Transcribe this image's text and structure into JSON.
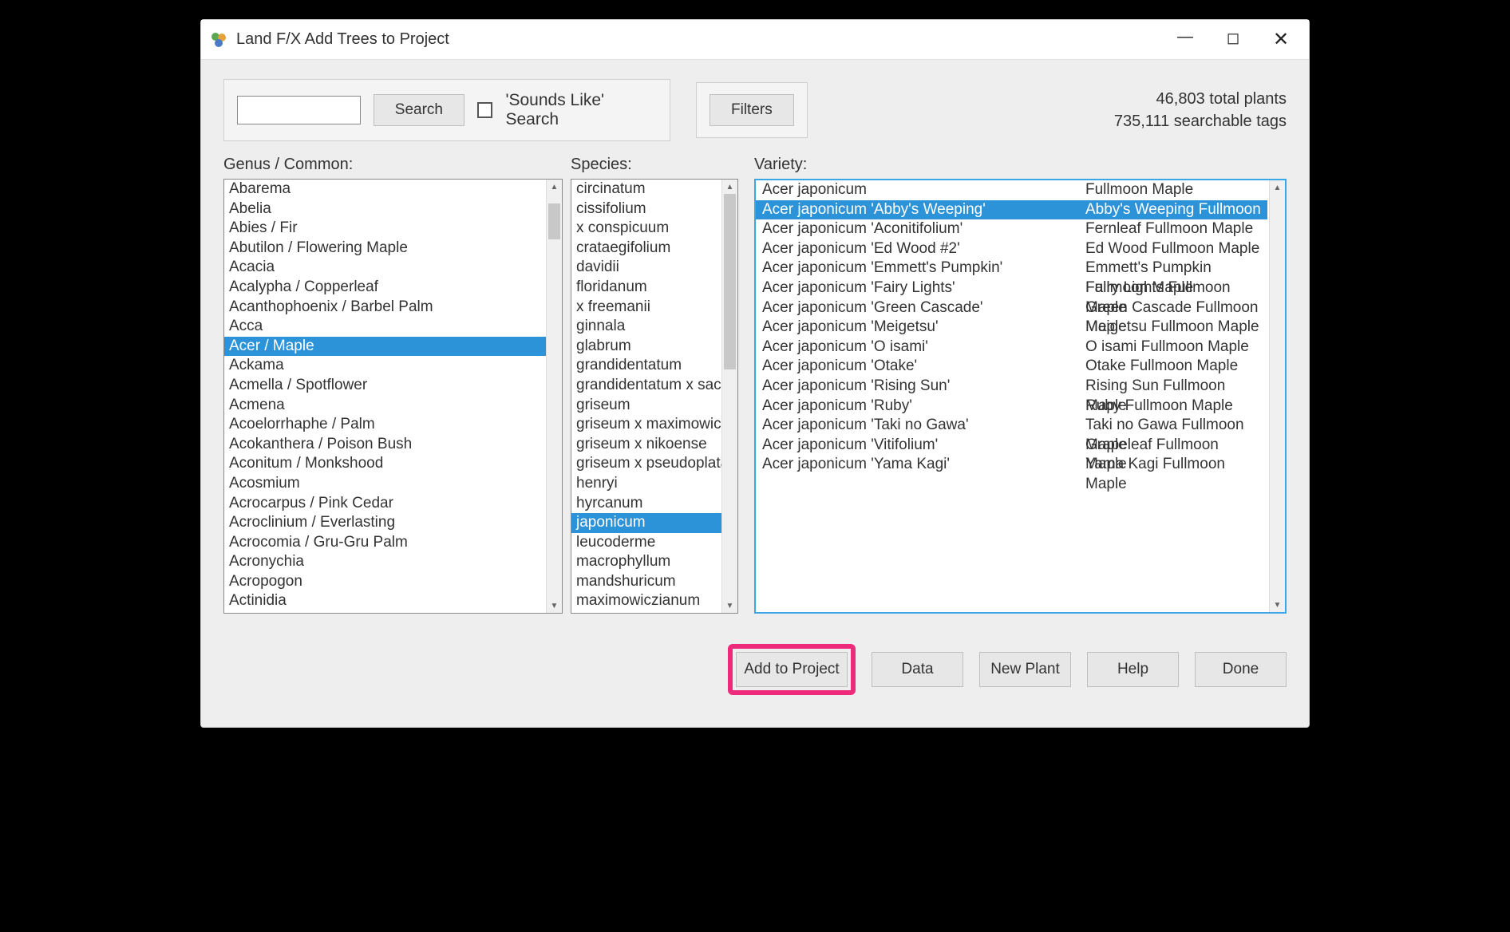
{
  "window": {
    "title": "Land F/X Add Trees to Project"
  },
  "toolbar": {
    "search_label": "Search",
    "sounds_like_label": "'Sounds Like' Search",
    "filters_label": "Filters",
    "stats_line1": "46,803 total plants",
    "stats_line2": "735,111 searchable tags"
  },
  "labels": {
    "genus": "Genus / Common:",
    "species": "Species:",
    "variety": "Variety:"
  },
  "genus": {
    "items": [
      "Abarema",
      "Abelia",
      "Abies / Fir",
      "Abutilon / Flowering Maple",
      "Acacia",
      "Acalypha / Copperleaf",
      "Acanthophoenix / Barbel Palm",
      "Acca",
      "Acer / Maple",
      "Ackama",
      "Acmella / Spotflower",
      "Acmena",
      "Acoelorrhaphe / Palm",
      "Acokanthera / Poison Bush",
      "Aconitum / Monkshood",
      "Acosmium",
      "Acrocarpus / Pink Cedar",
      "Acroclinium / Everlasting",
      "Acrocomia / Gru-Gru Palm",
      "Acronychia",
      "Acropogon",
      "Actinidia"
    ],
    "selected_index": 8
  },
  "species": {
    "items": [
      "circinatum",
      "cissifolium",
      "x conspicuum",
      "crataegifolium",
      "davidii",
      "floridanum",
      "x freemanii",
      "ginnala",
      "glabrum",
      "grandidentatum",
      "grandidentatum x saccharum",
      "griseum",
      "griseum x maximowiczianum",
      "griseum x nikoense",
      "griseum x pseudoplatanus",
      "henryi",
      "hyrcanum",
      "japonicum",
      "leucoderme",
      "macrophyllum",
      "mandshuricum",
      "maximowiczianum"
    ],
    "selected_index": 17
  },
  "variety": {
    "items": [
      {
        "name": "Acer japonicum",
        "common": "Fullmoon Maple"
      },
      {
        "name": "Acer japonicum 'Abby's Weeping'",
        "common": "Abby's Weeping Fullmoon Maple"
      },
      {
        "name": "Acer japonicum 'Aconitifolium'",
        "common": "Fernleaf Fullmoon Maple"
      },
      {
        "name": "Acer japonicum 'Ed Wood #2'",
        "common": "Ed Wood Fullmoon Maple"
      },
      {
        "name": "Acer japonicum 'Emmett's Pumpkin'",
        "common": "Emmett's Pumpkin Fullmoon Maple"
      },
      {
        "name": "Acer japonicum 'Fairy Lights'",
        "common": "Fairy Lights Fullmoon Maple"
      },
      {
        "name": "Acer japonicum 'Green Cascade'",
        "common": "Green Cascade Fullmoon Maple"
      },
      {
        "name": "Acer japonicum 'Meigetsu'",
        "common": "Meigetsu Fullmoon Maple"
      },
      {
        "name": "Acer japonicum 'O isami'",
        "common": "O isami Fullmoon Maple"
      },
      {
        "name": "Acer japonicum 'Otake'",
        "common": "Otake Fullmoon Maple"
      },
      {
        "name": "Acer japonicum 'Rising Sun'",
        "common": "Rising Sun Fullmoon Maple"
      },
      {
        "name": "Acer japonicum 'Ruby'",
        "common": "Ruby Fullmoon Maple"
      },
      {
        "name": "Acer japonicum 'Taki no Gawa'",
        "common": "Taki no Gawa Fullmoon Maple"
      },
      {
        "name": "Acer japonicum 'Vitifolium'",
        "common": "Grapeleaf Fullmoon Maple"
      },
      {
        "name": "Acer japonicum 'Yama Kagi'",
        "common": "Yama Kagi Fullmoon Maple"
      }
    ],
    "selected_index": 1
  },
  "footer": {
    "add_to_project": "Add to Project",
    "data": "Data",
    "new_plant": "New Plant",
    "help": "Help",
    "done": "Done"
  }
}
